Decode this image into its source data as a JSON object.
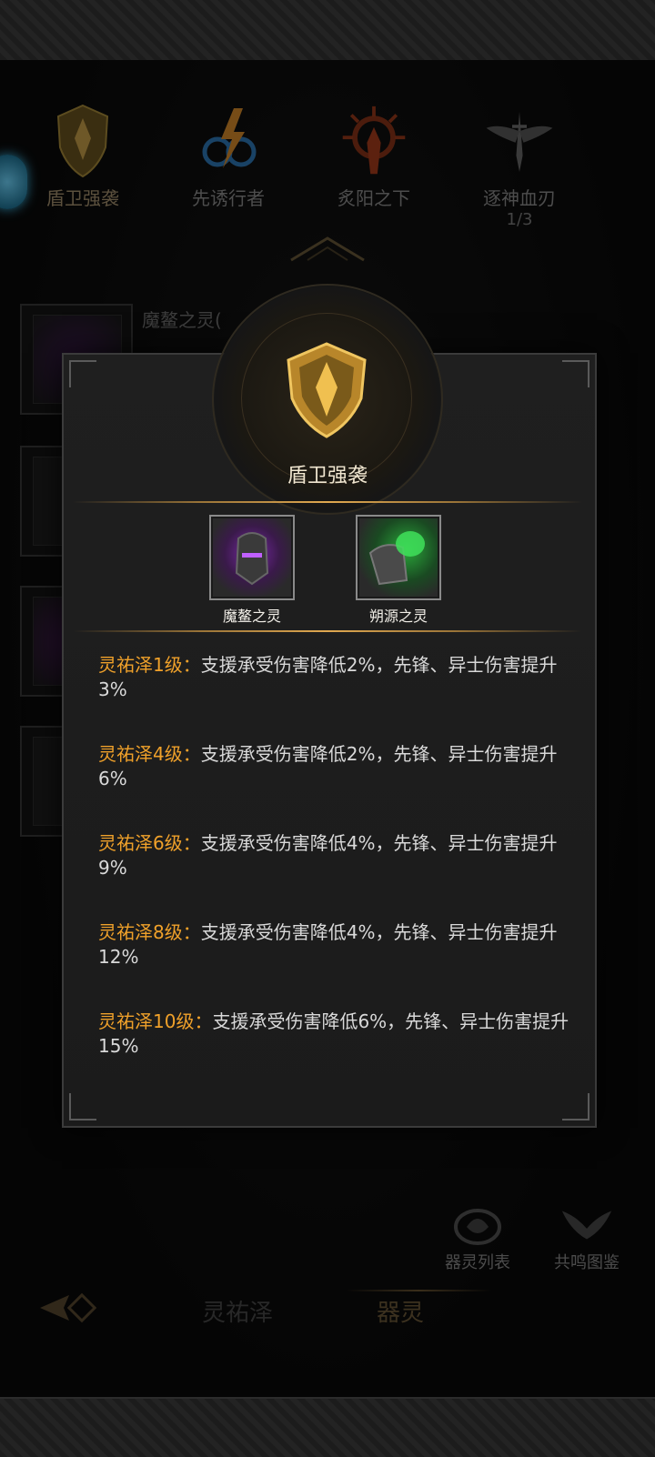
{
  "categories": [
    {
      "label": "盾卫强袭",
      "sub": ""
    },
    {
      "label": "先诱行者",
      "sub": ""
    },
    {
      "label": "炙阳之下",
      "sub": ""
    },
    {
      "label": "逐神血刃",
      "sub": "1/3"
    }
  ],
  "background_list": {
    "first_item_name": "魔鳌之灵(",
    "icons": [
      "helmet-icon",
      "armor-icon",
      "purple-cloak-icon",
      "gauntlet-icon"
    ]
  },
  "modal": {
    "title": "盾卫强袭",
    "materials": [
      {
        "name": "魔鳌之灵",
        "icon": "purple-helmet-icon"
      },
      {
        "name": "朔源之灵",
        "icon": "green-shoulder-icon"
      }
    ],
    "effects": [
      {
        "level": "灵祐泽1级：",
        "text": "支援承受伤害降低2%，先锋、异士伤害提升3%"
      },
      {
        "level": "灵祐泽4级：",
        "text": "支援承受伤害降低2%，先锋、异士伤害提升6%"
      },
      {
        "level": "灵祐泽6级：",
        "text": "支援承受伤害降低4%，先锋、异士伤害提升9%"
      },
      {
        "level": "灵祐泽8级：",
        "text": "支援承受伤害降低4%，先锋、异士伤害提升12%"
      },
      {
        "level": "灵祐泽10级：",
        "text": "支援承受伤害降低6%，先锋、异士伤害提升15%"
      }
    ]
  },
  "tools": [
    {
      "label": "器灵列表",
      "icon": "list-emblem-icon"
    },
    {
      "label": "共鸣图鉴",
      "icon": "wings-emblem-icon"
    }
  ],
  "tabs": [
    {
      "label": "灵祐泽"
    },
    {
      "label": "器灵"
    }
  ],
  "colors": {
    "accent_gold": "#f0a12a",
    "panel": "#1c1c1c"
  }
}
